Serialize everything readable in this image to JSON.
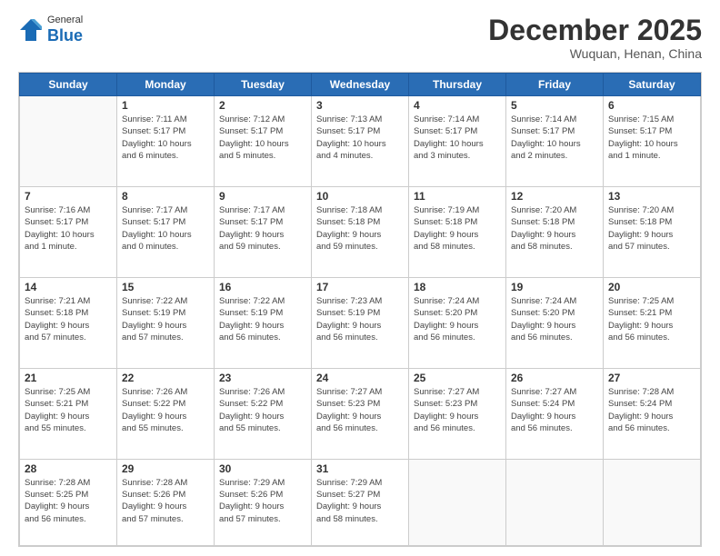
{
  "logo": {
    "general": "General",
    "blue": "Blue"
  },
  "header": {
    "month": "December 2025",
    "location": "Wuquan, Henan, China"
  },
  "days_of_week": [
    "Sunday",
    "Monday",
    "Tuesday",
    "Wednesday",
    "Thursday",
    "Friday",
    "Saturday"
  ],
  "weeks": [
    [
      {
        "num": "",
        "info": ""
      },
      {
        "num": "1",
        "info": "Sunrise: 7:11 AM\nSunset: 5:17 PM\nDaylight: 10 hours\nand 6 minutes."
      },
      {
        "num": "2",
        "info": "Sunrise: 7:12 AM\nSunset: 5:17 PM\nDaylight: 10 hours\nand 5 minutes."
      },
      {
        "num": "3",
        "info": "Sunrise: 7:13 AM\nSunset: 5:17 PM\nDaylight: 10 hours\nand 4 minutes."
      },
      {
        "num": "4",
        "info": "Sunrise: 7:14 AM\nSunset: 5:17 PM\nDaylight: 10 hours\nand 3 minutes."
      },
      {
        "num": "5",
        "info": "Sunrise: 7:14 AM\nSunset: 5:17 PM\nDaylight: 10 hours\nand 2 minutes."
      },
      {
        "num": "6",
        "info": "Sunrise: 7:15 AM\nSunset: 5:17 PM\nDaylight: 10 hours\nand 1 minute."
      }
    ],
    [
      {
        "num": "7",
        "info": "Sunrise: 7:16 AM\nSunset: 5:17 PM\nDaylight: 10 hours\nand 1 minute."
      },
      {
        "num": "8",
        "info": "Sunrise: 7:17 AM\nSunset: 5:17 PM\nDaylight: 10 hours\nand 0 minutes."
      },
      {
        "num": "9",
        "info": "Sunrise: 7:17 AM\nSunset: 5:17 PM\nDaylight: 9 hours\nand 59 minutes."
      },
      {
        "num": "10",
        "info": "Sunrise: 7:18 AM\nSunset: 5:18 PM\nDaylight: 9 hours\nand 59 minutes."
      },
      {
        "num": "11",
        "info": "Sunrise: 7:19 AM\nSunset: 5:18 PM\nDaylight: 9 hours\nand 58 minutes."
      },
      {
        "num": "12",
        "info": "Sunrise: 7:20 AM\nSunset: 5:18 PM\nDaylight: 9 hours\nand 58 minutes."
      },
      {
        "num": "13",
        "info": "Sunrise: 7:20 AM\nSunset: 5:18 PM\nDaylight: 9 hours\nand 57 minutes."
      }
    ],
    [
      {
        "num": "14",
        "info": "Sunrise: 7:21 AM\nSunset: 5:18 PM\nDaylight: 9 hours\nand 57 minutes."
      },
      {
        "num": "15",
        "info": "Sunrise: 7:22 AM\nSunset: 5:19 PM\nDaylight: 9 hours\nand 57 minutes."
      },
      {
        "num": "16",
        "info": "Sunrise: 7:22 AM\nSunset: 5:19 PM\nDaylight: 9 hours\nand 56 minutes."
      },
      {
        "num": "17",
        "info": "Sunrise: 7:23 AM\nSunset: 5:19 PM\nDaylight: 9 hours\nand 56 minutes."
      },
      {
        "num": "18",
        "info": "Sunrise: 7:24 AM\nSunset: 5:20 PM\nDaylight: 9 hours\nand 56 minutes."
      },
      {
        "num": "19",
        "info": "Sunrise: 7:24 AM\nSunset: 5:20 PM\nDaylight: 9 hours\nand 56 minutes."
      },
      {
        "num": "20",
        "info": "Sunrise: 7:25 AM\nSunset: 5:21 PM\nDaylight: 9 hours\nand 56 minutes."
      }
    ],
    [
      {
        "num": "21",
        "info": "Sunrise: 7:25 AM\nSunset: 5:21 PM\nDaylight: 9 hours\nand 55 minutes."
      },
      {
        "num": "22",
        "info": "Sunrise: 7:26 AM\nSunset: 5:22 PM\nDaylight: 9 hours\nand 55 minutes."
      },
      {
        "num": "23",
        "info": "Sunrise: 7:26 AM\nSunset: 5:22 PM\nDaylight: 9 hours\nand 55 minutes."
      },
      {
        "num": "24",
        "info": "Sunrise: 7:27 AM\nSunset: 5:23 PM\nDaylight: 9 hours\nand 56 minutes."
      },
      {
        "num": "25",
        "info": "Sunrise: 7:27 AM\nSunset: 5:23 PM\nDaylight: 9 hours\nand 56 minutes."
      },
      {
        "num": "26",
        "info": "Sunrise: 7:27 AM\nSunset: 5:24 PM\nDaylight: 9 hours\nand 56 minutes."
      },
      {
        "num": "27",
        "info": "Sunrise: 7:28 AM\nSunset: 5:24 PM\nDaylight: 9 hours\nand 56 minutes."
      }
    ],
    [
      {
        "num": "28",
        "info": "Sunrise: 7:28 AM\nSunset: 5:25 PM\nDaylight: 9 hours\nand 56 minutes."
      },
      {
        "num": "29",
        "info": "Sunrise: 7:28 AM\nSunset: 5:26 PM\nDaylight: 9 hours\nand 57 minutes."
      },
      {
        "num": "30",
        "info": "Sunrise: 7:29 AM\nSunset: 5:26 PM\nDaylight: 9 hours\nand 57 minutes."
      },
      {
        "num": "31",
        "info": "Sunrise: 7:29 AM\nSunset: 5:27 PM\nDaylight: 9 hours\nand 58 minutes."
      },
      {
        "num": "",
        "info": ""
      },
      {
        "num": "",
        "info": ""
      },
      {
        "num": "",
        "info": ""
      }
    ]
  ]
}
